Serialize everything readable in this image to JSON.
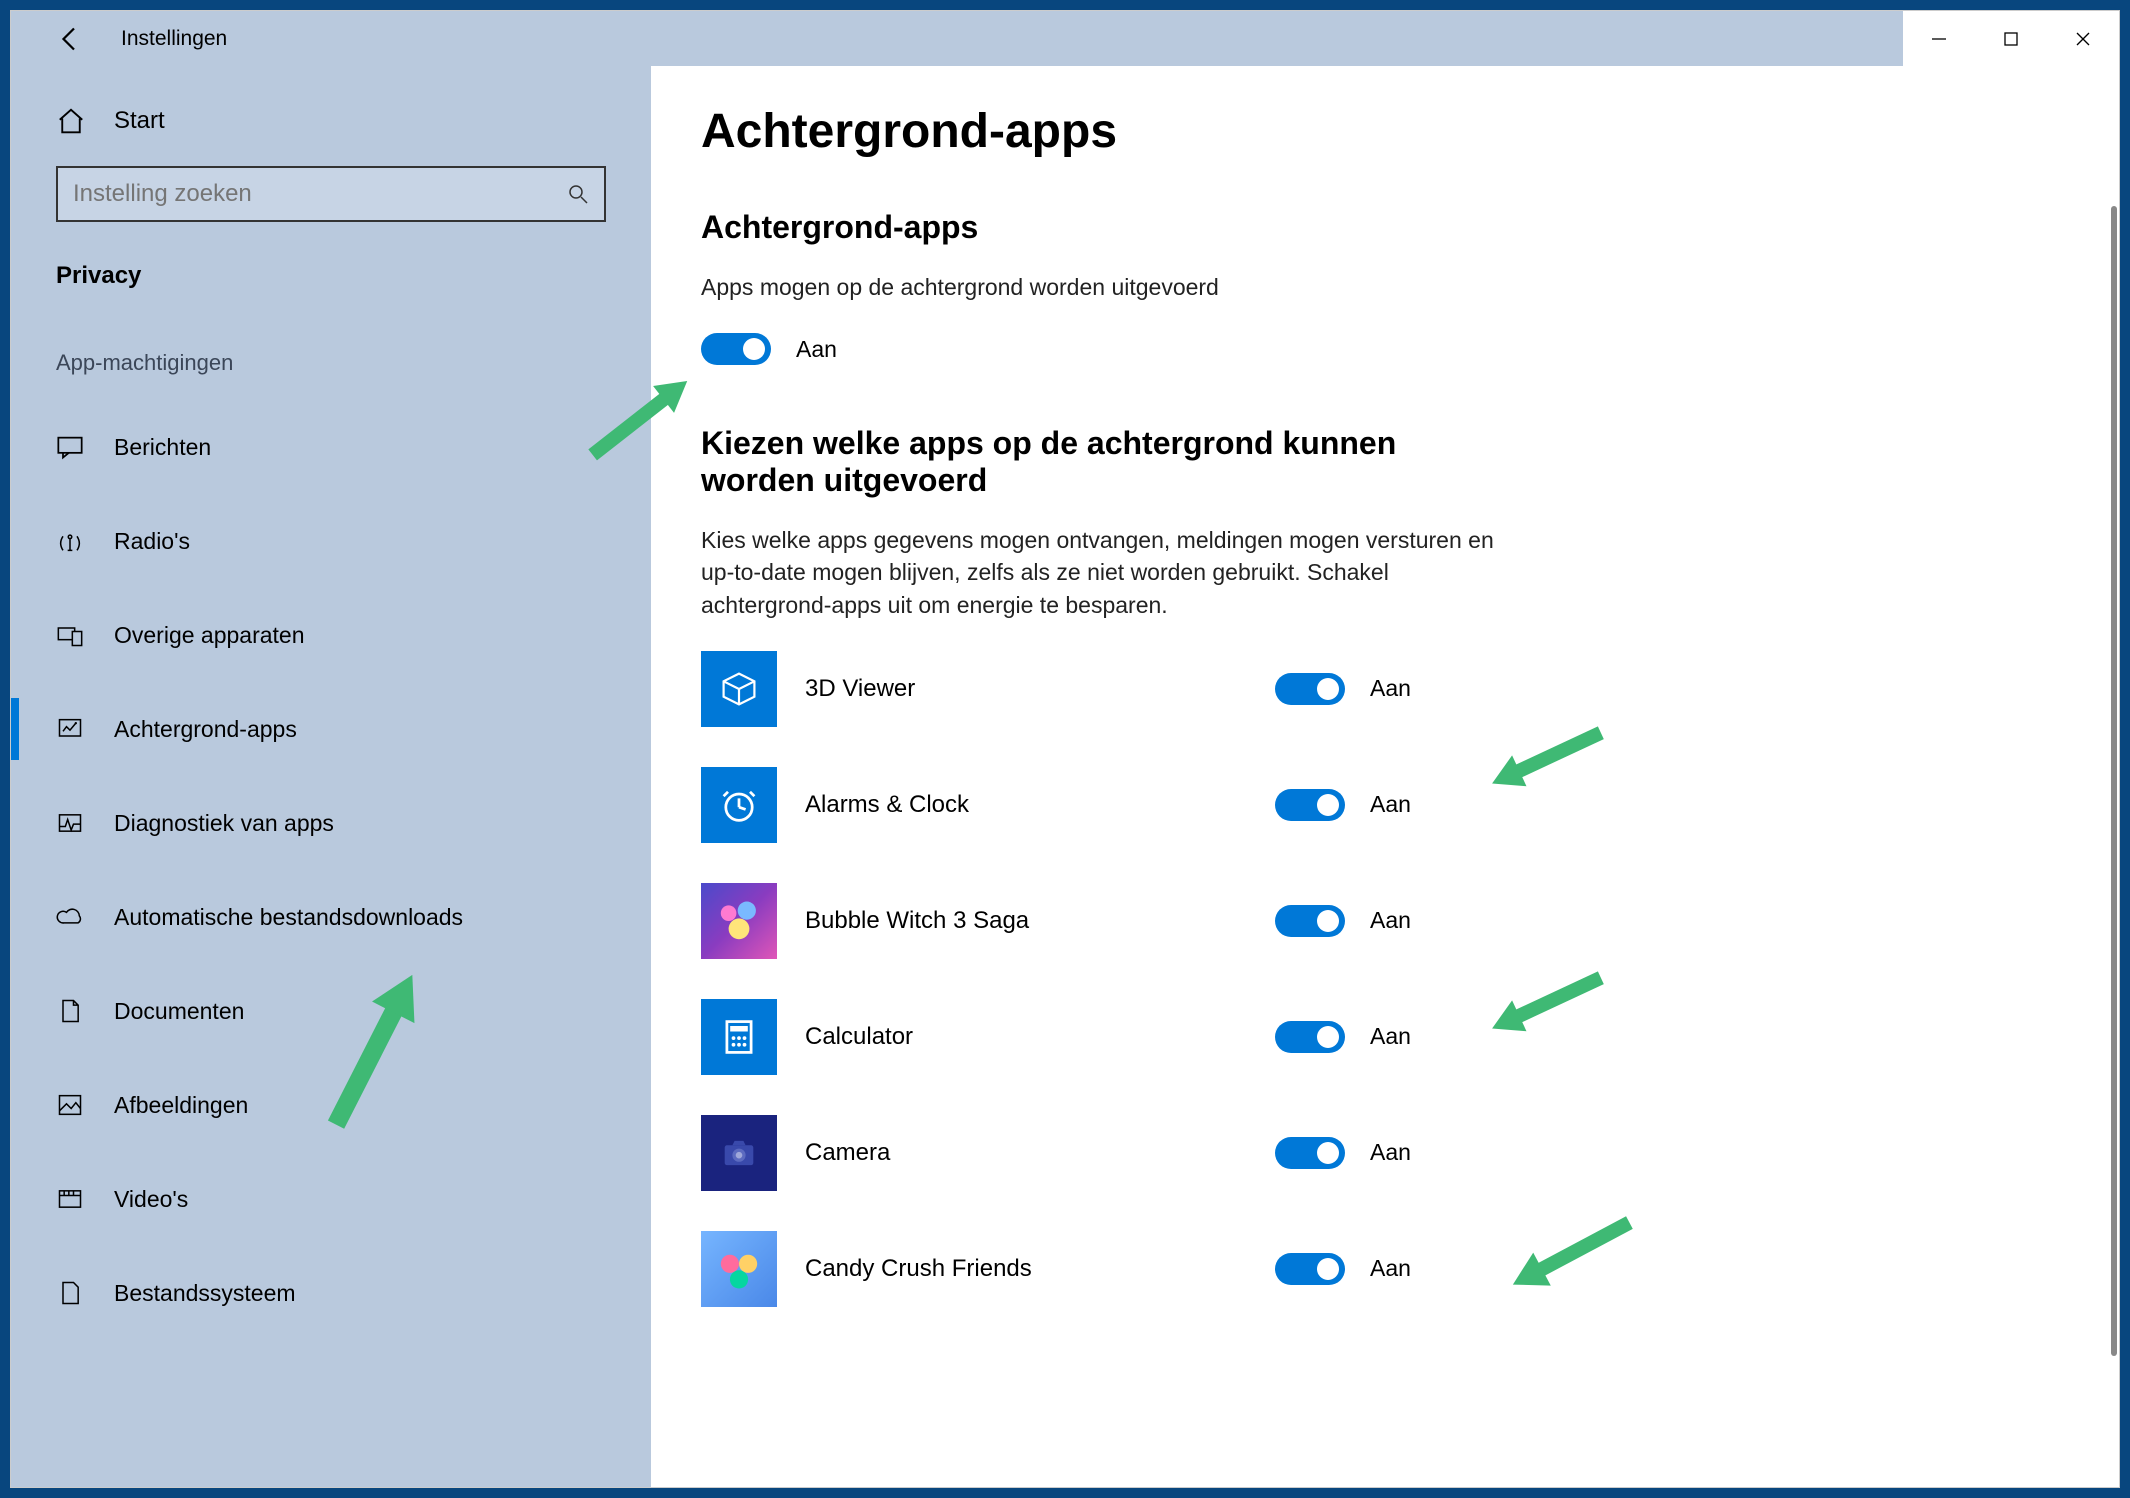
{
  "titlebar": {
    "title": "Instellingen"
  },
  "sidebar": {
    "home_label": "Start",
    "search_placeholder": "Instelling zoeken",
    "category": "Privacy",
    "section_label": "App-machtigingen",
    "items": [
      {
        "label": "Berichten"
      },
      {
        "label": "Radio's"
      },
      {
        "label": "Overige apparaten"
      },
      {
        "label": "Achtergrond-apps"
      },
      {
        "label": "Diagnostiek van apps"
      },
      {
        "label": "Automatische bestandsdownloads"
      },
      {
        "label": "Documenten"
      },
      {
        "label": "Afbeeldingen"
      },
      {
        "label": "Video's"
      },
      {
        "label": "Bestandssysteem"
      }
    ]
  },
  "main": {
    "title": "Achtergrond-apps",
    "section1": {
      "heading": "Achtergrond-apps",
      "description": "Apps mogen op de achtergrond worden uitgevoerd",
      "toggle_state": "Aan"
    },
    "section2": {
      "heading": "Kiezen welke apps op de achtergrond kunnen worden uitgevoerd",
      "description": "Kies welke apps gegevens mogen ontvangen, meldingen mogen versturen en up-to-date mogen blijven, zelfs als ze niet worden gebruikt. Schakel achtergrond-apps uit om energie te besparen."
    },
    "apps": [
      {
        "name": "3D Viewer",
        "state": "Aan"
      },
      {
        "name": "Alarms & Clock",
        "state": "Aan"
      },
      {
        "name": "Bubble Witch 3 Saga",
        "state": "Aan"
      },
      {
        "name": "Calculator",
        "state": "Aan"
      },
      {
        "name": "Camera",
        "state": "Aan"
      },
      {
        "name": "Candy Crush Friends",
        "state": "Aan"
      }
    ]
  },
  "colors": {
    "accent": "#0078d7",
    "sidebar_bg": "#b9c9dd",
    "annotation": "#3fb974"
  }
}
